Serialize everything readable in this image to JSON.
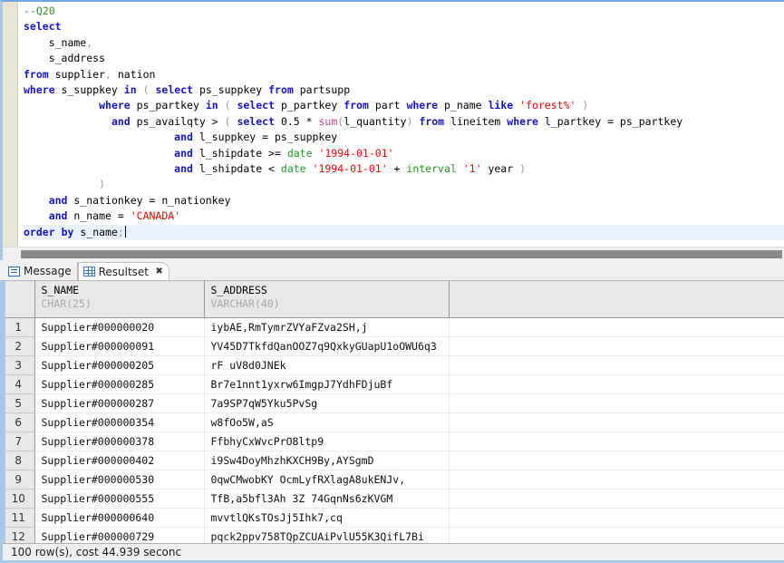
{
  "editor": {
    "comment": "--Q20",
    "sql_lines": [
      "--Q20",
      "select",
      "    s_name,",
      "    s_address",
      "from supplier, nation",
      "where s_suppkey in ( select ps_suppkey from partsupp",
      "            where ps_partkey in ( select p_partkey from part where p_name like 'forest%' )",
      "              and ps_availqty > ( select 0.5 * sum(l_quantity) from lineitem where l_partkey = ps_partkey",
      "                        and l_suppkey = ps_suppkey",
      "                        and l_shipdate >= date '1994-01-01'",
      "                        and l_shipdate < date '1994-01-01' + interval '1' year )",
      "            )",
      "    and s_nationkey = n_nationkey",
      "    and n_name = 'CANADA'",
      "order by s_name;"
    ],
    "current_line": "order by s_name;"
  },
  "tabs": [
    {
      "label": "Message",
      "icon": "message-icon",
      "active": false,
      "closable": false
    },
    {
      "label": "Resultset",
      "icon": "grid-icon",
      "active": true,
      "closable": true,
      "close_glyph": "✖"
    }
  ],
  "grid": {
    "columns": [
      {
        "name": "",
        "type": ""
      },
      {
        "name": "S_NAME",
        "type": "CHAR(25)"
      },
      {
        "name": "S_ADDRESS",
        "type": "VARCHAR(40)"
      },
      {
        "name": "",
        "type": ""
      }
    ],
    "rows": [
      {
        "n": "1",
        "s_name": "Supplier#000000020",
        "s_address": "iybAE,RmTymrZVYaFZva2SH,j"
      },
      {
        "n": "2",
        "s_name": "Supplier#000000091",
        "s_address": "YV45D7TkfdQanOOZ7q9QxkyGUapU1oOWU6q3"
      },
      {
        "n": "3",
        "s_name": "Supplier#000000205",
        "s_address": "rF uV8d0JNEk"
      },
      {
        "n": "4",
        "s_name": "Supplier#000000285",
        "s_address": "Br7e1nnt1yxrw6ImgpJ7YdhFDjuBf"
      },
      {
        "n": "5",
        "s_name": "Supplier#000000287",
        "s_address": "7a9SP7qW5Yku5PvSg"
      },
      {
        "n": "6",
        "s_name": "Supplier#000000354",
        "s_address": "w8fOo5W,aS"
      },
      {
        "n": "7",
        "s_name": "Supplier#000000378",
        "s_address": "FfbhyCxWvcPrO8ltp9"
      },
      {
        "n": "8",
        "s_name": "Supplier#000000402",
        "s_address": "i9Sw4DoyMhzhKXCH9By,AYSgmD"
      },
      {
        "n": "9",
        "s_name": "Supplier#000000530",
        "s_address": "0qwCMwobKY OcmLyfRXlagA8ukENJv,"
      },
      {
        "n": "10",
        "s_name": "Supplier#000000555",
        "s_address": "TfB,a5bfl3Ah 3Z 74GqnNs6zKVGM"
      },
      {
        "n": "11",
        "s_name": "Supplier#000000640",
        "s_address": "mvvtlQKsTOsJj5Ihk7,cq"
      },
      {
        "n": "12",
        "s_name": "Supplier#000000729",
        "s_address": "pqck2ppv758TQpZCUAiPvlU55K3QifL7Bi"
      }
    ]
  },
  "status": {
    "text": "100 row(s), cost 44.939 seconc"
  }
}
